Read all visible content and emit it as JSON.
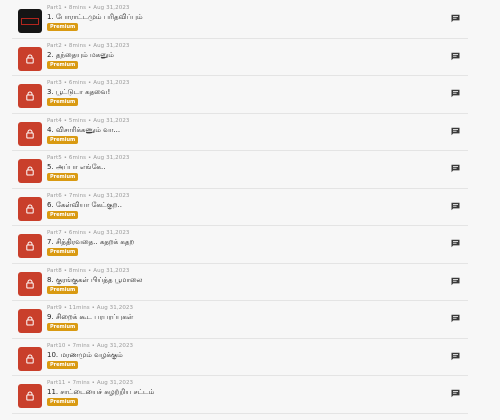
{
  "episodes": [
    {
      "part": "Part1",
      "duration": "8mins",
      "date": "Aug 31,2023",
      "title": "1. போராட்டமும் பரிதவிப்பும்",
      "badge": "Premium",
      "thumb": "cover"
    },
    {
      "part": "Part2",
      "duration": "8mins",
      "date": "Aug 31,2023",
      "title": "2. தந்தையும் மகனும்",
      "badge": "Premium",
      "thumb": "lock"
    },
    {
      "part": "Part3",
      "duration": "6mins",
      "date": "Aug 31,2023",
      "title": "3. பூட்டுடா கதவை!",
      "badge": "Premium",
      "thumb": "lock"
    },
    {
      "part": "Part4",
      "duration": "5mins",
      "date": "Aug 31,2023",
      "title": "4. விசாரிக்கணும் வா...",
      "badge": "Premium",
      "thumb": "lock"
    },
    {
      "part": "Part5",
      "duration": "6mins",
      "date": "Aug 31,2023",
      "title": "5. அப்பா எங்கே..",
      "badge": "Premium",
      "thumb": "lock"
    },
    {
      "part": "Part6",
      "duration": "7mins",
      "date": "Aug 31,2023",
      "title": "6. கேள்வியா கேட்குற..",
      "badge": "Premium",
      "thumb": "lock"
    },
    {
      "part": "Part7",
      "duration": "6mins",
      "date": "Aug 31,2023",
      "title": "7. சித்திரவதை.. கதறக் கதற",
      "badge": "Premium",
      "thumb": "lock"
    },
    {
      "part": "Part8",
      "duration": "8mins",
      "date": "Aug 31,2023",
      "title": "8. குரங்குகள் பிய்த்த பூமாலை",
      "badge": "Premium",
      "thumb": "lock"
    },
    {
      "part": "Part9",
      "duration": "11mins",
      "date": "Aug 31,2023",
      "title": "9. சிறைக் கூட பரபரப்புகள்",
      "badge": "Premium",
      "thumb": "lock"
    },
    {
      "part": "Part10",
      "duration": "7mins",
      "date": "Aug 31,2023",
      "title": "10. மரணமும் வழக்கும்",
      "badge": "Premium",
      "thumb": "lock"
    },
    {
      "part": "Part11",
      "duration": "7mins",
      "date": "Aug 31,2023",
      "title": "11. சாட்டையைச் சுழற்றிய சட்டம்",
      "badge": "Premium",
      "thumb": "lock"
    }
  ],
  "meta_separator": " • ",
  "icons": {
    "thumb": "lock-icon",
    "action": "comment-icon"
  },
  "colors": {
    "thumb_bg": "#c93f2b",
    "badge_bg": "#d99a12",
    "accent_dark": "#151515"
  }
}
